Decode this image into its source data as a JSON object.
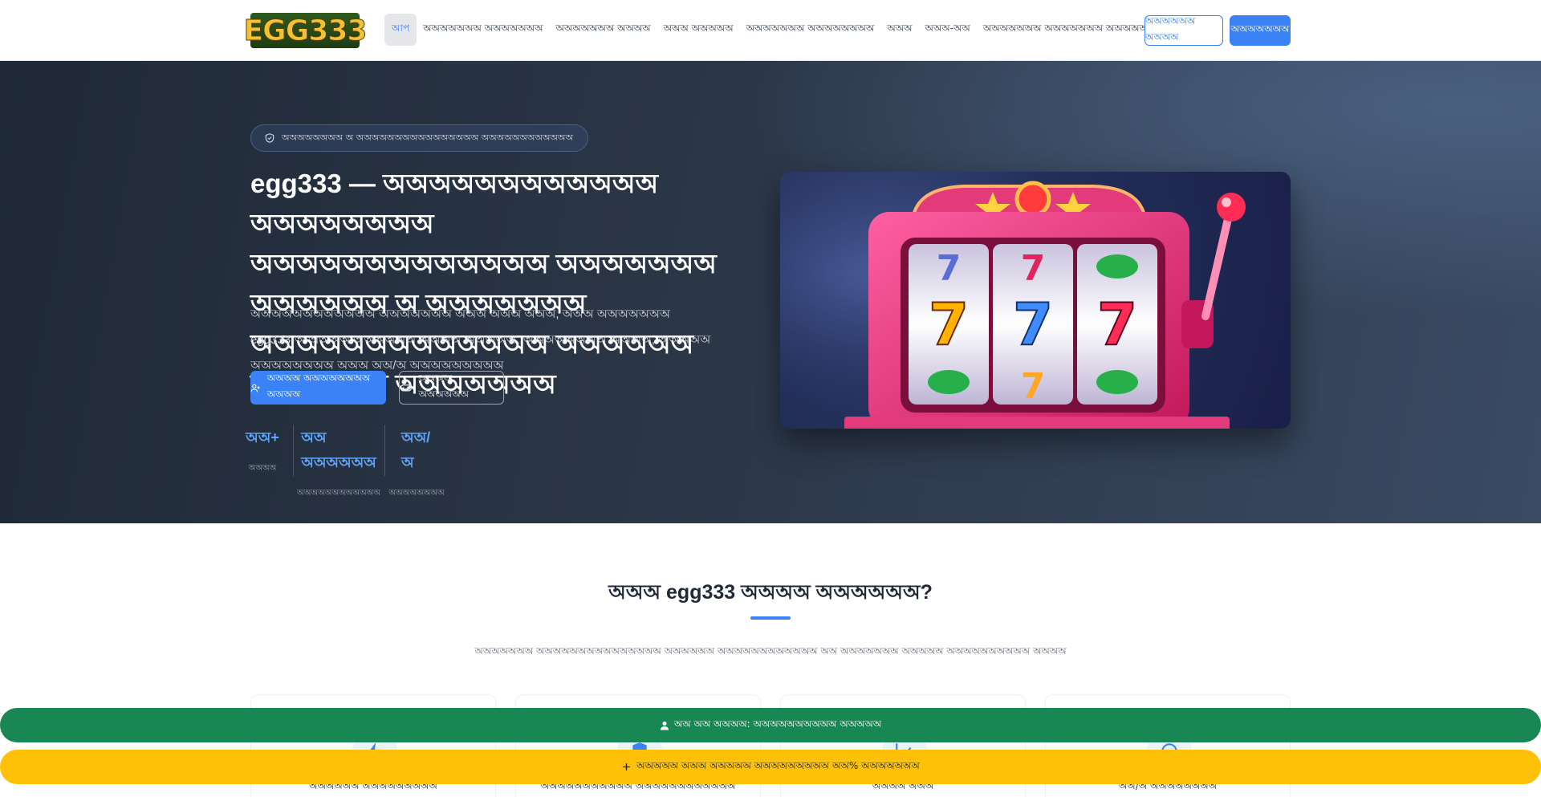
{
  "nav": {
    "logo_text": "EGG333",
    "menu": [
      "আপ",
      "অঅঅঅঅঅঅ অঅঅঅঅঅঅ",
      "অঅঅঅঅঅঅ অঅঅঅ",
      "অঅঅ অঅঅঅঅ",
      "অঅঅঅঅঅঅ অঅঅঅঅঅঅঅ",
      "অঅঅ",
      "অঅঅ-অঅ",
      "অঅঅঅঅঅঅ অঅঅঅঅঅঅ অঅঅঅঅঅ"
    ],
    "login_label": "অঅঅঅঅঅ অঅঅঅ",
    "register_label": "অঅঅঅঅঅঅ"
  },
  "hero": {
    "badge": "অঅঅঅঅঅঅঅ অ অঅঅঅঅঅঅঅঅঅঅঅঅঅঅঅ অঅঅঅঅঅঅঅঅঅঅঅ",
    "title": "egg333 — অঅঅঅঅঅঅঅঅঅঅঅ অঅঅঅঅঅঅঅ অঅঅঅঅঅঅঅঅঅঅঅঅ অঅঅঅঅঅঅ অঅঅঅঅঅ অ অঅঅঅঅঅঅ অঅঅঅঅঅঅঅঅঅঅঅঅ অঅঅঅঅঅ অঅঅঅঅঅ অঅঅঅঅঅঅ",
    "description": "অঅঅঅঅঅঅঅঅঅঅঅ অঅঅঅঅঅঅ অঅঅ অঅঅ অঅঅ, অঅঅ অঅঅঅঅঅঅ egg333-অ অঅঅঅ অঅঅঅঅঅ অঅঅঅ অঅঅঅঅ, অঅঅঅঅঅঅঅ অঅঅঅ, অঅঅঅঅ অঅঅঅঅঅঅঅ অঅঅ অঅ/অ অঅঅঅঅঅঅঅঅ",
    "cta_primary": "অঅঅঅ অঅঅঅঅঅঅঅ অঅঅঅ",
    "cta_secondary": "অঅঅঅ অঅঅঅঅঅ",
    "stats": [
      {
        "value": "অঅ+",
        "label": "অঅঅঅ"
      },
      {
        "value": "অঅ অঅঅঅঅঅ",
        "label": "অঅঅঅঅঅঅঅঅঅঅঅ"
      },
      {
        "value": "অঅ/অ",
        "label": "অঅঅঅঅঅঅঅ"
      }
    ]
  },
  "section": {
    "title": "অঅঅ egg333 অঅঅঅ অঅঅঅঅঅ?",
    "subtitle": "অঅঅঅঅঅঅ অঅঅঅঅঅঅঅঅঅঅঅঅঅঅ অঅঅঅঅঅ অঅঅঅঅঅঅঅঅঅঅঅ অঅ অঅঅঅঅঅঅ অঅঅঅঅ অঅঅঅঅঅঅঅঅঅ অঅঅঅ",
    "features": [
      {
        "label": "অঅঅঅঅঅ অঅঅঅঅঅঅঅঅ",
        "icon": "lightning-icon"
      },
      {
        "label": "অঅঅঅঅঅঅঅঅঅঅ অঅঅঅঅঅঅঅঅঅঅঅ",
        "icon": "shield-icon"
      },
      {
        "label": "অঅঅঅ অঅঅ",
        "icon": "chart-icon"
      },
      {
        "label": "অঅ/অ অঅঅঅঅঅঅঅ",
        "icon": "support-icon"
      }
    ]
  },
  "bars": {
    "green": "অঅ অঅ অঅঅঅ: অঅঅঅঅঅঅঅঅঅ অঅঅঅঅ",
    "yellow": "অঅঅঅঅ অঅঅ অঅঅঅঅ অঅঅঅঅঅঅঅঅ অঅ% অঅঅঅঅঅঅ"
  },
  "colors": {
    "accent": "#3b82f6",
    "hero_bg": "#2b3647",
    "green_bar": "#198754",
    "yellow_bar": "#ffc107"
  }
}
